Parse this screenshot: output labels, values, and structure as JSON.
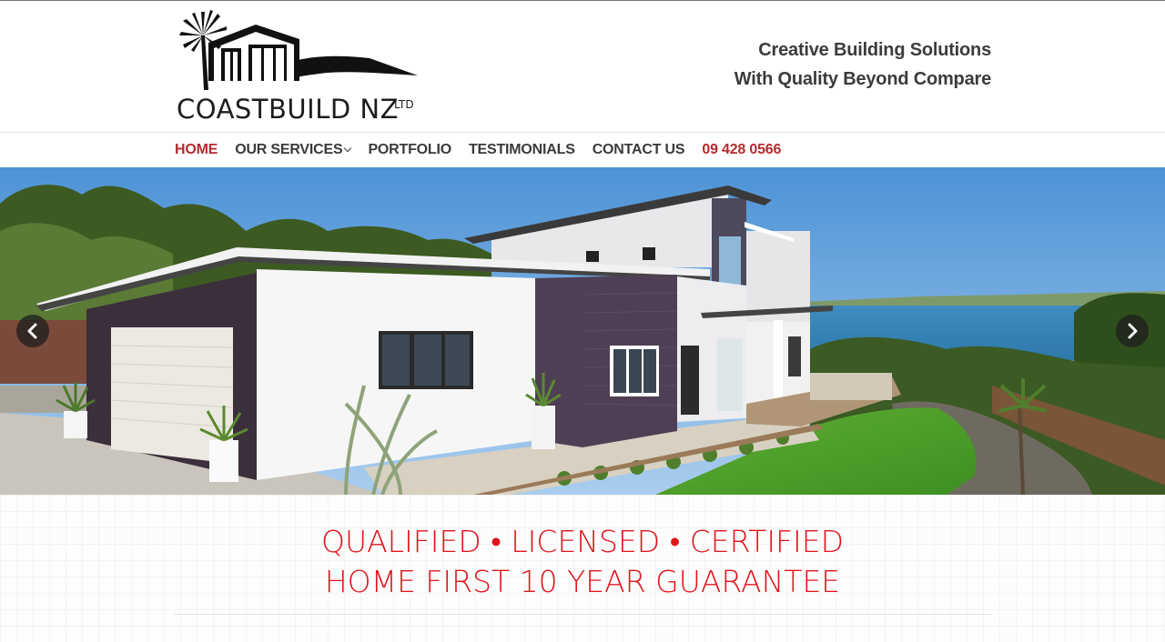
{
  "brand": {
    "name": "COASTBUILD NZ",
    "suffix": "LTD"
  },
  "tagline": {
    "line1": "Creative Building Solutions",
    "line2": "With Quality Beyond Compare"
  },
  "nav": {
    "items": [
      {
        "label": "HOME",
        "active": true
      },
      {
        "label": "OUR SERVICES",
        "has_dropdown": true
      },
      {
        "label": "PORTFOLIO"
      },
      {
        "label": "TESTIMONIALS"
      },
      {
        "label": "CONTACT US"
      },
      {
        "label": "09 428 0566",
        "type": "phone"
      }
    ]
  },
  "slider": {
    "prev_icon": "chevron-left-icon",
    "next_icon": "chevron-right-icon"
  },
  "claims": {
    "line1": "QUALIFIED • LICENSED • CERTIFIED",
    "line2": "HOME FIRST 10 YEAR GUARANTEE"
  },
  "colors": {
    "accent": "#b52b2b",
    "claims": "#e0151b",
    "text": "#3a3a3a"
  }
}
